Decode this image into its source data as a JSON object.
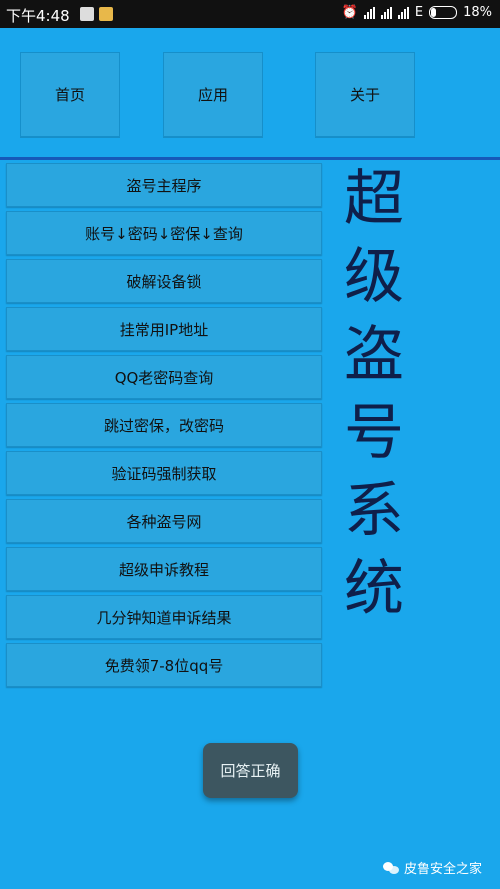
{
  "status_bar": {
    "time": "下午4:48",
    "network_label": "E",
    "battery": "18%"
  },
  "nav": {
    "home": "首页",
    "apps": "应用",
    "about": "关于"
  },
  "menu": [
    "盗号主程序",
    "账号↓密码↓密保↓查询",
    "破解设备锁",
    "挂常用IP地址",
    "QQ老密码查询",
    "跳过密保，改密码",
    "验证码强制获取",
    "各种盗号网",
    "超级申诉教程",
    "几分钟知道申诉结果",
    "免费领7-8位qq号"
  ],
  "title": "超级盗号系统",
  "answer_button": "回答正确",
  "watermark": "皮鲁安全之家",
  "colors": {
    "background": "#1aa7ec",
    "divider": "#1659b8",
    "title": "#0f1f4a",
    "answer_button": "#3d5660"
  }
}
